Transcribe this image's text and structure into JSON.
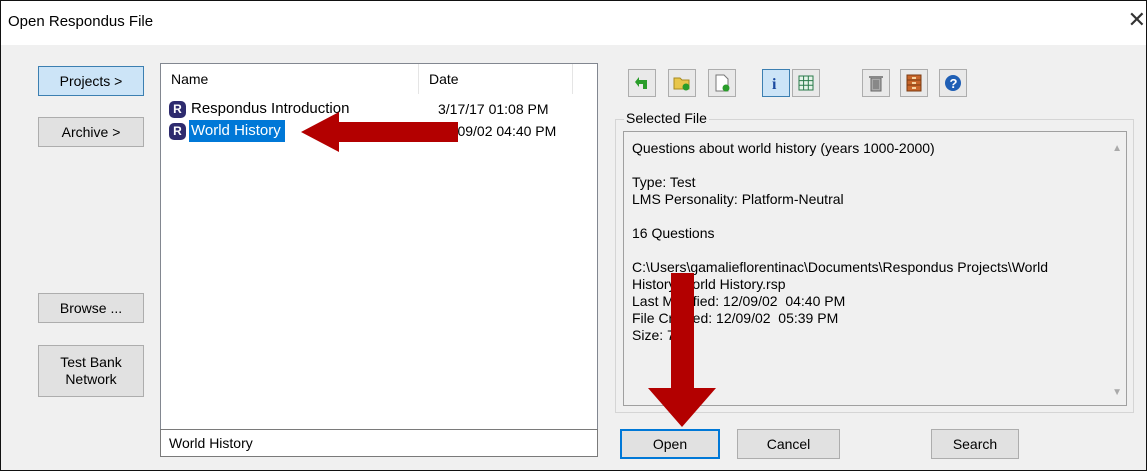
{
  "window": {
    "title": "Open Respondus File",
    "close_glyph": "✕"
  },
  "left_nav": {
    "projects": "Projects >",
    "archive": "Archive >",
    "browse": "Browse ...",
    "test_bank": "Test Bank\nNetwork"
  },
  "file_list": {
    "columns": {
      "name": "Name",
      "date": "Date"
    },
    "rows": [
      {
        "icon": "R",
        "name": "Respondus Introduction",
        "date": "3/17/17  01:08 PM"
      },
      {
        "icon": "R",
        "name": "World History",
        "date": "12/09/02  04:40 PM"
      }
    ],
    "selected_index": 1
  },
  "filename_input": {
    "value": "World History"
  },
  "toolbar": {
    "icons": [
      "back-arrow-icon",
      "folder-icon",
      "new-file-icon",
      "info-icon",
      "grid-icon",
      "trash-icon",
      "archive-icon",
      "help-icon"
    ]
  },
  "selected_file": {
    "label": "Selected File",
    "description": "Questions about world history (years 1000-2000)",
    "type": "Type: Test",
    "lms": "LMS Personality: Platform-Neutral",
    "questions": "16 Questions",
    "path": "C:\\Users\\gamalieflorentinac\\Documents\\Respondus Projects\\World History\\World History.rsp",
    "last_modified": "Last Modified: 12/09/02  04:40 PM",
    "file_created": "File Created: 12/09/02  05:39 PM",
    "size": "Size: 7 K"
  },
  "actions": {
    "open": "Open",
    "cancel": "Cancel",
    "search": "Search"
  },
  "colors": {
    "annotation_arrow": "#b30000",
    "selection": "#0078d7",
    "r_icon": "#2e2b6e"
  }
}
